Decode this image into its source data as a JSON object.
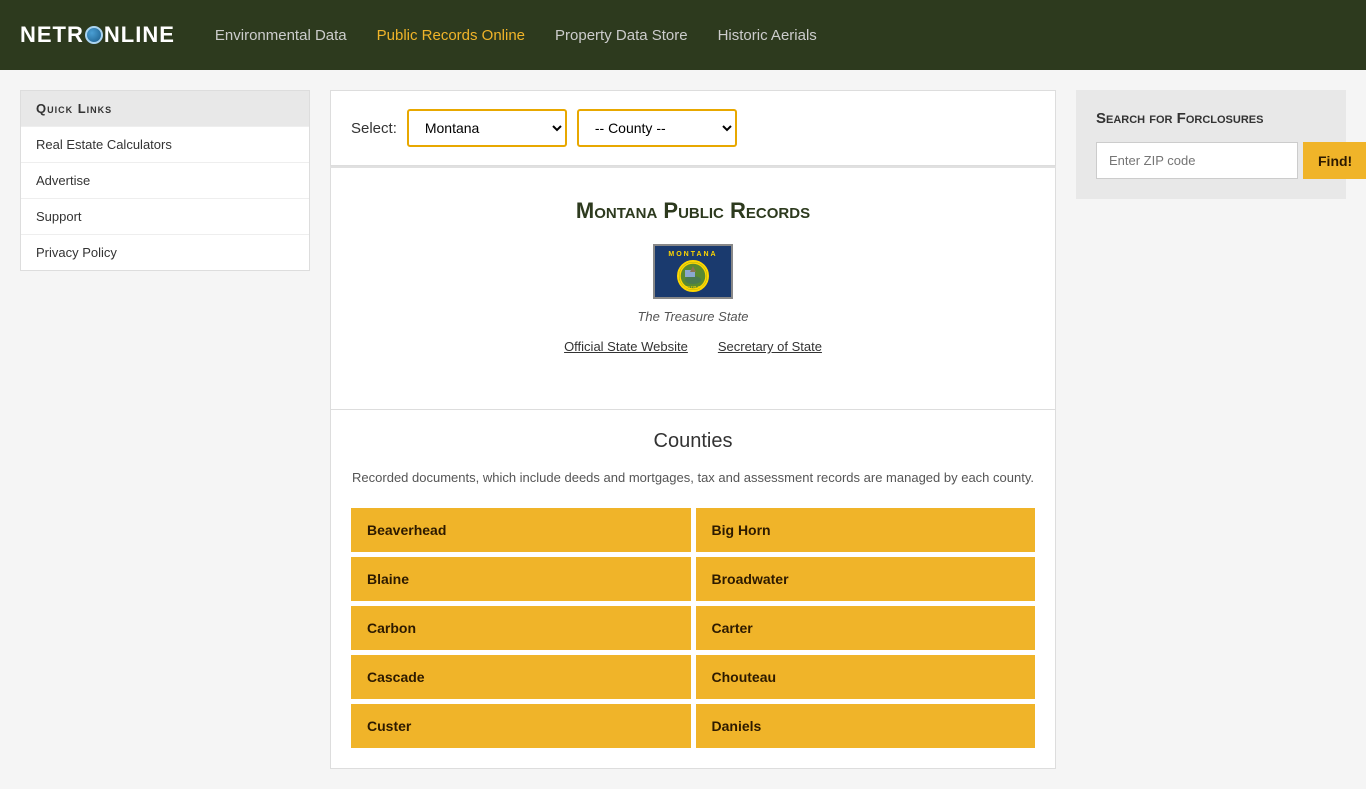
{
  "header": {
    "logo_text_before": "NETR",
    "logo_text_after": "NLINE",
    "nav_items": [
      {
        "label": "Environmental Data",
        "active": false,
        "id": "env"
      },
      {
        "label": "Public Records Online",
        "active": true,
        "id": "pub"
      },
      {
        "label": "Property Data Store",
        "active": false,
        "id": "prop"
      },
      {
        "label": "Historic Aerials",
        "active": false,
        "id": "hist"
      }
    ]
  },
  "select": {
    "label": "Select:",
    "state_selected": "Montana",
    "county_placeholder": "-- County --",
    "states": [
      "Montana"
    ],
    "counties": []
  },
  "state_info": {
    "title": "Montana Public Records",
    "nickname": "The Treasure State",
    "links": [
      {
        "label": "Official State Website",
        "href": "#"
      },
      {
        "label": "Secretary of State",
        "href": "#"
      }
    ]
  },
  "counties": {
    "title": "Counties",
    "description": "Recorded documents, which include deeds and mortgages, tax and assessment records are managed by each county.",
    "items": [
      "Beaverhead",
      "Big Horn",
      "Blaine",
      "Broadwater",
      "Carbon",
      "Carter",
      "Cascade",
      "Chouteau",
      "Custer",
      "Daniels"
    ]
  },
  "quick_links": {
    "title": "Quick Links",
    "items": [
      "Real Estate Calculators",
      "Advertise",
      "Support",
      "Privacy Policy"
    ]
  },
  "foreclosure": {
    "title": "Search for Forclosures",
    "zip_placeholder": "Enter ZIP code",
    "button_label": "Find!"
  }
}
